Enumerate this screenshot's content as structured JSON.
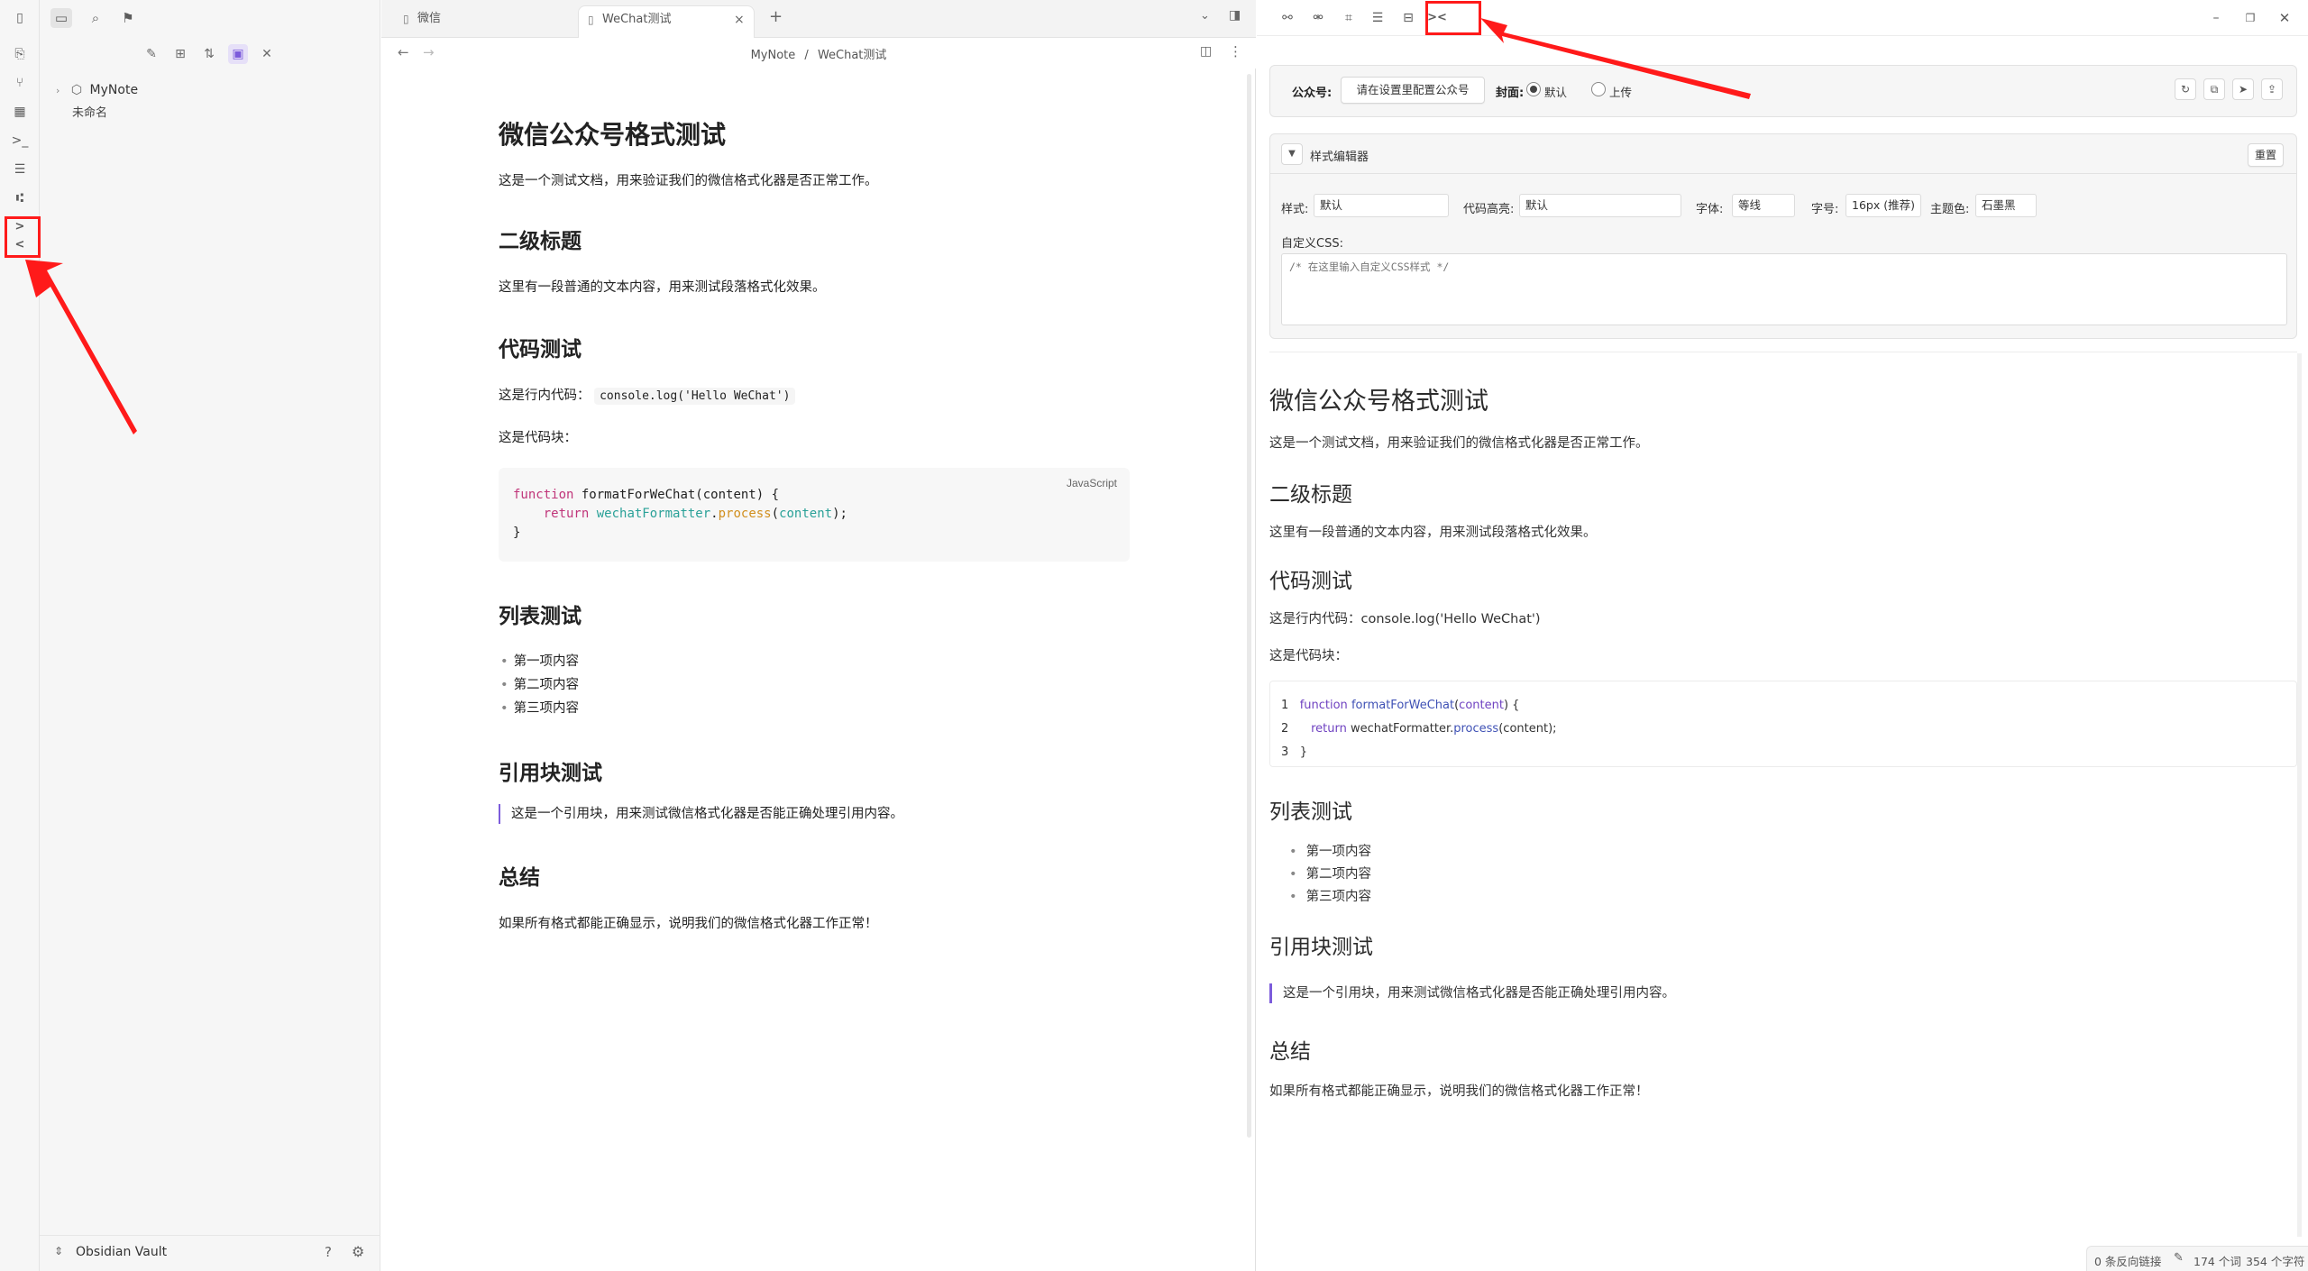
{
  "left_ribbon": {
    "icons": [
      "sidebar-toggle-icon",
      "files-icon",
      "graph-icon",
      "grid-icon",
      "terminal-icon",
      "list-icon",
      "git-icon",
      "wechat-format-icon"
    ]
  },
  "sidebar": {
    "folder": "MyNote",
    "file": "未命名",
    "vault_name": "Obsidian Vault"
  },
  "tabs": [
    {
      "label": "微信"
    },
    {
      "label": "WeChat测试"
    }
  ],
  "breadcrumb": {
    "folder": "MyNote",
    "sep": "/",
    "note": "WeChat测试"
  },
  "doc": {
    "h1": "微信公众号格式测试",
    "intro": "这是一个测试文档，用来验证我们的微信格式化器是否正常工作。",
    "h2_1": "二级标题",
    "p1": "这里有一段普通的文本内容，用来测试段落格式化效果。",
    "h2_2": "代码测试",
    "inline_prefix": "这是行内代码：",
    "inline_code": "console.log('Hello WeChat')",
    "codeblock_prefix": "这是代码块：",
    "code_lang": "JavaScript",
    "code": {
      "l1_kw": "function",
      "l1_rest": " formatForWeChat(content) {",
      "l2_kw": "return",
      "l2_obj": "wechatFormatter",
      "l2_dot": ".",
      "l2_method": "process",
      "l2_open": "(",
      "l2_arg": "content",
      "l2_close": ");",
      "l3": "}"
    },
    "h2_3": "列表测试",
    "list": [
      "第一项内容",
      "第二项内容",
      "第三项内容"
    ],
    "h2_4": "引用块测试",
    "quote": "这是一个引用块，用来测试微信格式化器是否能正确处理引用内容。",
    "h2_5": "总结",
    "summary": "如果所有格式都能正确显示，说明我们的微信格式化器工作正常！"
  },
  "right_panel": {
    "account_label": "公众号:",
    "account_button": "请在设置里配置公众号",
    "cover_label": "封面:",
    "cover_default": "默认",
    "cover_upload": "上传",
    "style_editor_title": "样式编辑器",
    "reset": "重置",
    "style_label": "样式:",
    "style_value": "默认",
    "highlight_label": "代码高亮:",
    "highlight_value": "默认",
    "font_label": "字体:",
    "font_value": "等线",
    "size_label": "字号:",
    "size_value": "16px (推荐)",
    "theme_label": "主题色:",
    "theme_value": "石墨黑",
    "css_label": "自定义CSS:",
    "css_placeholder": "/* 在这里输入自定义CSS样式 */"
  },
  "preview": {
    "h1": "微信公众号格式测试",
    "intro": "这是一个测试文档，用来验证我们的微信格式化器是否正常工作。",
    "h2_1": "二级标题",
    "p1": "这里有一段普通的文本内容，用来测试段落格式化效果。",
    "h2_2": "代码测试",
    "inline": "这是行内代码：console.log('Hello WeChat')",
    "codeblock_prefix": "这是代码块：",
    "code_lines": [
      {
        "num": "1",
        "kw": "function",
        "fn": "formatForWeChat",
        "rest": "(",
        "arg": "content",
        "end": ") {"
      },
      {
        "num": "2",
        "kw": "return",
        "fn": "wechatFormatter.",
        "rest": "process",
        "arg": "",
        "end": "(content);"
      },
      {
        "num": "3",
        "kw": "",
        "fn": "",
        "rest": "}",
        "arg": "",
        "end": ""
      }
    ],
    "h2_3": "列表测试",
    "list": [
      "第一项内容",
      "第二项内容",
      "第三项内容"
    ],
    "h2_4": "引用块测试",
    "quote": "这是一个引用块，用来测试微信格式化器是否能正确处理引用内容。",
    "h2_5": "总结",
    "summary": "如果所有格式都能正确显示，说明我们的微信格式化器工作正常！"
  },
  "status": {
    "backlinks": "0 条反向链接",
    "words": "174 个词",
    "chars": "354 个字符"
  },
  "colors": {
    "accent": "#7c5cdb",
    "annotation": "#ff1a1a"
  }
}
